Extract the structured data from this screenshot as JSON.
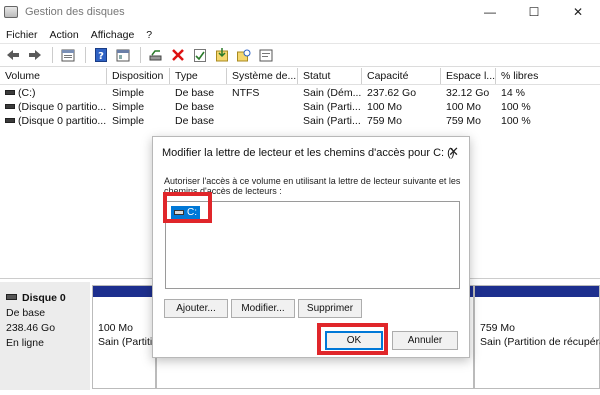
{
  "window": {
    "title": "Gestion des disques",
    "minimize": "—",
    "maximize": "☐",
    "close": "✕"
  },
  "menu": [
    "Fichier",
    "Action",
    "Affichage",
    "?"
  ],
  "toolbar": {
    "buttons": [
      "back-icon",
      "forward-icon",
      "properties-icon",
      "help-icon",
      "console-icon",
      "connect-icon",
      "delete-icon",
      "check-icon",
      "import-icon",
      "refresh-icon",
      "settings-icon"
    ]
  },
  "volumes": {
    "headers": [
      "Volume",
      "Disposition",
      "Type",
      "Système de...",
      "Statut",
      "Capacité",
      "Espace l...",
      "% libres"
    ],
    "rows": [
      [
        "(C:)",
        "Simple",
        "De base",
        "NTFS",
        "Sain (Dém...",
        "237.62 Go",
        "32.12 Go",
        "14 %"
      ],
      [
        "(Disque 0 partitio...",
        "Simple",
        "De base",
        "",
        "Sain (Parti...",
        "100 Mo",
        "100 Mo",
        "100 %"
      ],
      [
        "(Disque 0 partitio...",
        "Simple",
        "De base",
        "",
        "Sain (Parti...",
        "759 Mo",
        "759 Mo",
        "100 %"
      ]
    ]
  },
  "disk": {
    "name": "Disque 0",
    "type": "De base",
    "size": "238.46 Go",
    "status": "En ligne"
  },
  "partitions": [
    {
      "size": "100 Mo",
      "status": "Sain (Partitio"
    },
    {
      "size": "759 Mo",
      "status": "Sain (Partition de récupérat"
    }
  ],
  "dialog": {
    "title": "Modifier la lettre de lecteur et les chemins d'accès pour C: ()",
    "close": "✕",
    "description": "Autoriser l'accès à ce volume en utilisant la lettre de lecteur suivante et les chemins d'accès de lecteurs :",
    "entry": "C:",
    "add": "Ajouter...",
    "modify": "Modifier...",
    "remove": "Supprimer",
    "ok": "OK",
    "cancel": "Annuler"
  },
  "colors": {
    "partition_stripe": "#1d2f8e",
    "highlight": "#e0262a",
    "selection": "#0078d7"
  }
}
